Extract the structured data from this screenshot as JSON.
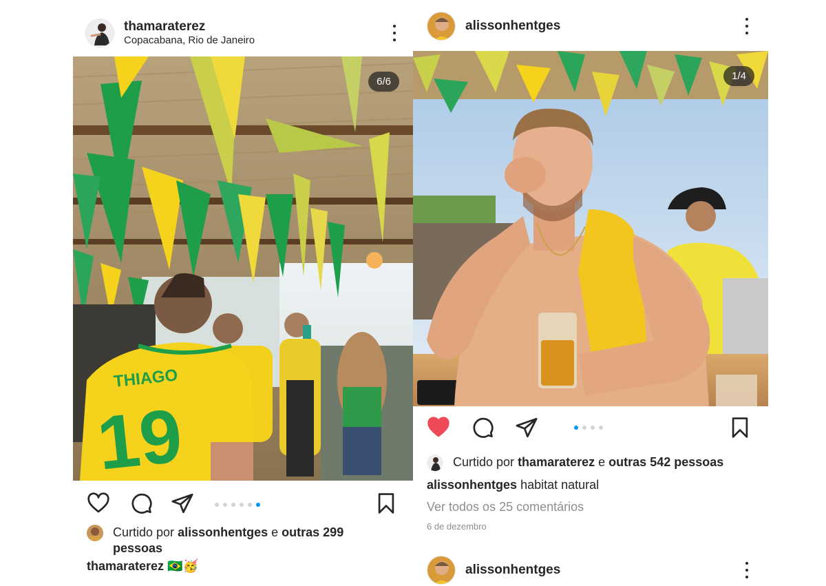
{
  "left_post": {
    "username": "thamaraterez",
    "location": "Copacabana, Rio de Janeiro",
    "counter": "6/6",
    "jersey_name": "THIAGO",
    "jersey_number": "19",
    "carousel_dots": 6,
    "carousel_active": 5,
    "liked": false,
    "likes_prefix": "Curtido por",
    "likes_user": "alissonhentges",
    "likes_mid": "e",
    "likes_others": "outras 299 pessoas",
    "caption_user": "thamaraterez",
    "caption_text": "🇧🇷🥳"
  },
  "right_post": {
    "username": "alissonhentges",
    "counter": "1/4",
    "carousel_dots": 4,
    "carousel_active": 0,
    "liked": true,
    "likes_prefix": "Curtido por",
    "likes_user": "thamaraterez",
    "likes_mid": "e",
    "likes_others": "outras 542 pessoas",
    "caption_user": "alissonhentges",
    "caption_text": "habitat natural",
    "comments_link": "Ver todos os 25 comentários",
    "date": "6 de dezembro"
  },
  "next_post": {
    "username": "alissonhentges"
  },
  "icons": {
    "like": "heart-icon",
    "comment": "comment-bubble-icon",
    "share": "paper-plane-icon",
    "save": "bookmark-icon",
    "more": "more-vertical-icon"
  },
  "colors": {
    "like_active": "#ed4956",
    "dot_active": "#0095f6",
    "brazil_yellow": "#f5d21c",
    "brazil_green": "#1f9e4a"
  }
}
